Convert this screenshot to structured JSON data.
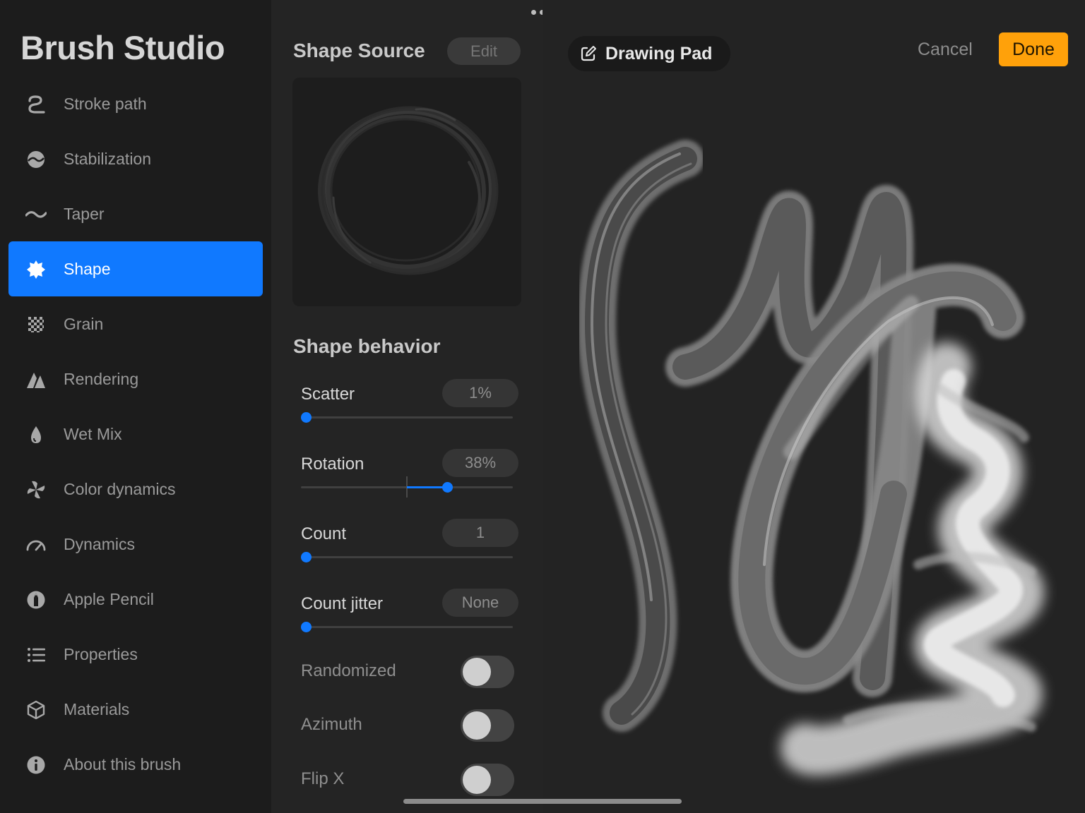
{
  "sidebar": {
    "title": "Brush Studio",
    "items": [
      {
        "label": "Stroke path",
        "icon": "stroke-path-icon",
        "active": false
      },
      {
        "label": "Stabilization",
        "icon": "stabilization-icon",
        "active": false
      },
      {
        "label": "Taper",
        "icon": "taper-icon",
        "active": false
      },
      {
        "label": "Shape",
        "icon": "shape-icon",
        "active": true
      },
      {
        "label": "Grain",
        "icon": "grain-icon",
        "active": false
      },
      {
        "label": "Rendering",
        "icon": "rendering-icon",
        "active": false
      },
      {
        "label": "Wet Mix",
        "icon": "wet-mix-icon",
        "active": false
      },
      {
        "label": "Color dynamics",
        "icon": "color-dynamics-icon",
        "active": false
      },
      {
        "label": "Dynamics",
        "icon": "dynamics-icon",
        "active": false
      },
      {
        "label": "Apple Pencil",
        "icon": "apple-pencil-icon",
        "active": false
      },
      {
        "label": "Properties",
        "icon": "properties-icon",
        "active": false
      },
      {
        "label": "Materials",
        "icon": "materials-icon",
        "active": false
      },
      {
        "label": "About this brush",
        "icon": "info-icon",
        "active": false
      }
    ]
  },
  "shape_source": {
    "title": "Shape Source",
    "edit_label": "Edit"
  },
  "shape_behavior": {
    "title": "Shape behavior",
    "sliders": [
      {
        "label": "Scatter",
        "value": "1%",
        "level": 0.01
      },
      {
        "label": "Rotation",
        "value": "38%",
        "level": 0.69
      },
      {
        "label": "Count",
        "value": "1",
        "level": 0.0
      },
      {
        "label": "Count jitter",
        "value": "None",
        "level": 0.0
      }
    ],
    "toggles": [
      {
        "label": "Randomized",
        "on": false
      },
      {
        "label": "Azimuth",
        "on": false
      },
      {
        "label": "Flip X",
        "on": false
      }
    ]
  },
  "drawing_pad": {
    "label": "Drawing Pad",
    "cancel_label": "Cancel",
    "done_label": "Done"
  },
  "colors": {
    "accent": "#1079ff",
    "done": "#ffa10a"
  }
}
